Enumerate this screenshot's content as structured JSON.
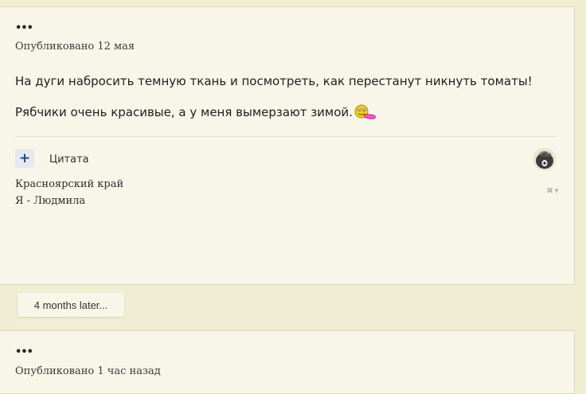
{
  "posts": [
    {
      "dots": "•••",
      "published": "Опубликовано 12 мая",
      "paragraphs": [
        "На дуги набросить темную ткань и посмотреть, как перестанут никнуть томаты!",
        "Рябчики очень красивые, а у меня вымерзают зимой."
      ],
      "quote_button": "+",
      "quote_label": "Цитата",
      "signature": [
        "Красноярский край",
        "Я - Людмила"
      ],
      "controls": "✖▾",
      "icons": {
        "emoji": "tongue-out-smiley-icon",
        "avatar": "user-avatar-icon"
      }
    },
    {
      "dots": "•••",
      "published": "Опубликовано 1 час назад"
    }
  ],
  "separator": {
    "label": "4 months later..."
  },
  "colors": {
    "page_background": "#efedd2",
    "post_background": "#f7f6e8",
    "accent_blue": "#1c4d8c"
  }
}
